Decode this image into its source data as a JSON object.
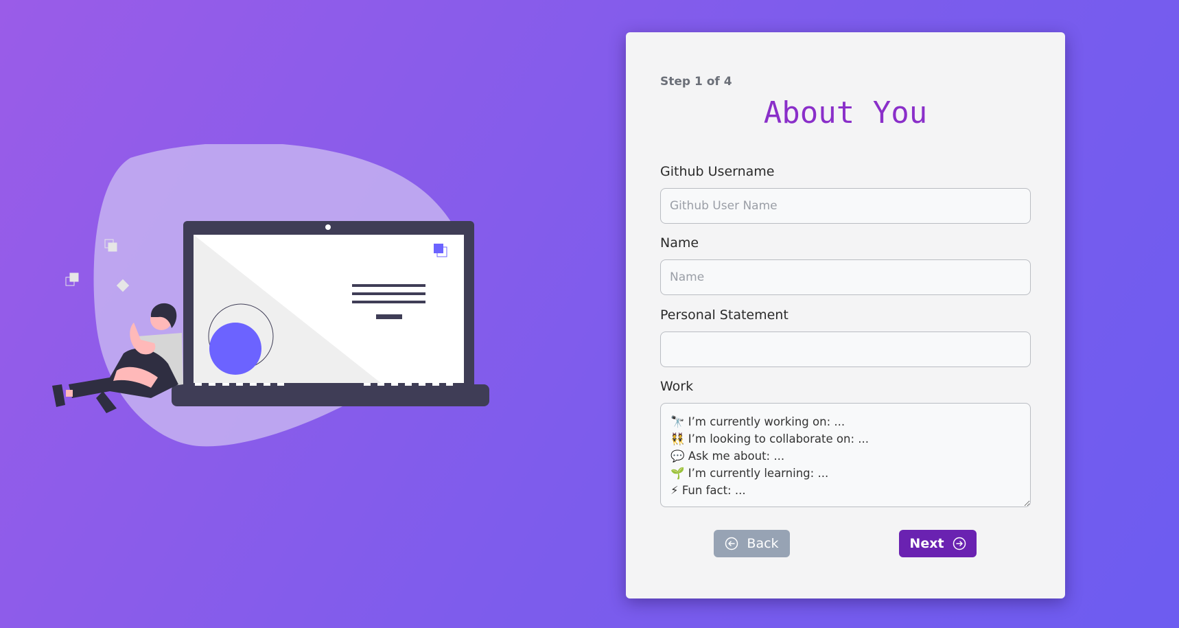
{
  "form": {
    "step": "Step 1 of 4",
    "title": "About You",
    "fields": {
      "github": {
        "label": "Github Username",
        "placeholder": "Github User Name",
        "value": ""
      },
      "name": {
        "label": "Name",
        "placeholder": "Name",
        "value": ""
      },
      "statement": {
        "label": "Personal Statement",
        "placeholder": "",
        "value": ""
      },
      "work": {
        "label": "Work",
        "value": "🔭 I’m currently working on: ...\n👯 I’m looking to collaborate on: ...\n💬 Ask me about: ...\n🌱 I’m currently learning: ...\n⚡ Fun fact: ..."
      }
    },
    "buttons": {
      "back": {
        "label": "Back",
        "icon": "arrow-left-circle-icon"
      },
      "next": {
        "label": "Next",
        "icon": "arrow-right-circle-icon"
      }
    }
  },
  "colors": {
    "background_start": "#9a5ce8",
    "background_end": "#6d5cf0",
    "card": "#f4f4f5",
    "title": "#8a2fc9",
    "next_button": "#6a22b1",
    "back_button": "#97a3b4"
  }
}
